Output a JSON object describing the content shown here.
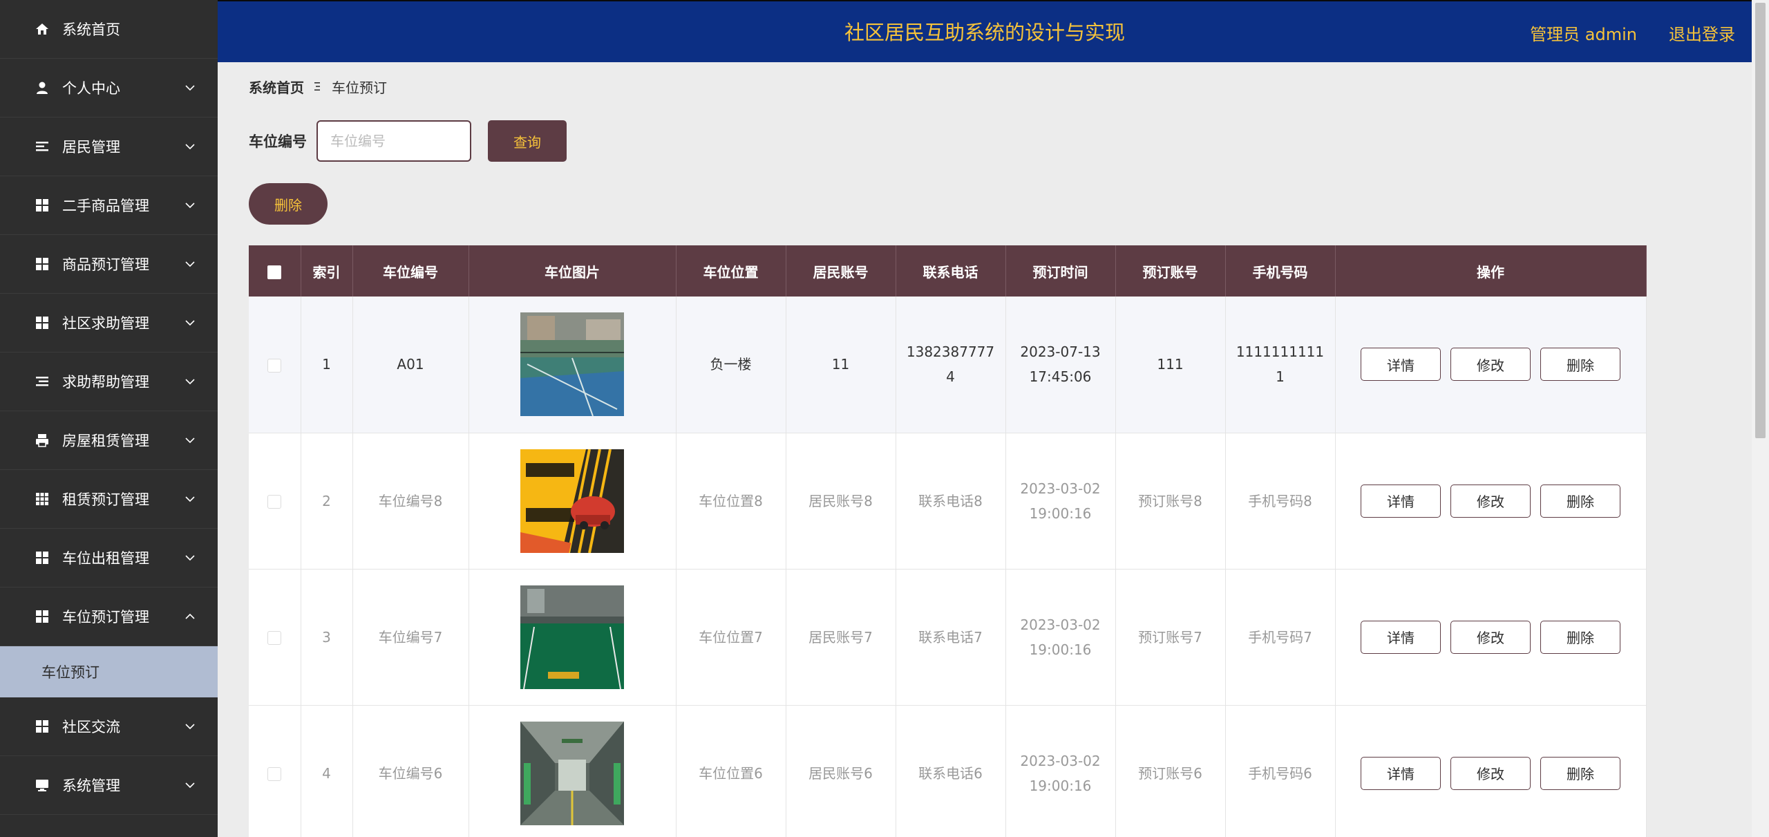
{
  "header": {
    "title": "社区居民互助系统的设计与实现",
    "admin_label": "管理员 admin",
    "logout_label": "退出登录"
  },
  "sidebar": {
    "items": [
      {
        "label": "系统首页",
        "icon": "home-icon",
        "expandable": false
      },
      {
        "label": "个人中心",
        "icon": "user-icon",
        "expandable": true
      },
      {
        "label": "居民管理",
        "icon": "list-icon",
        "expandable": true
      },
      {
        "label": "二手商品管理",
        "icon": "grid-icon",
        "expandable": true
      },
      {
        "label": "商品预订管理",
        "icon": "grid-icon",
        "expandable": true
      },
      {
        "label": "社区求助管理",
        "icon": "grid-icon",
        "expandable": true
      },
      {
        "label": "求助帮助管理",
        "icon": "list-icon",
        "expandable": true
      },
      {
        "label": "房屋租赁管理",
        "icon": "printer-icon",
        "expandable": true
      },
      {
        "label": "租赁预订管理",
        "icon": "grid-9-icon",
        "expandable": true
      },
      {
        "label": "车位出租管理",
        "icon": "grid-icon",
        "expandable": true
      },
      {
        "label": "车位预订管理",
        "icon": "grid-icon",
        "expandable": true,
        "expanded": true
      },
      {
        "label": "社区交流",
        "icon": "grid-icon",
        "expandable": true
      },
      {
        "label": "系统管理",
        "icon": "monitor-icon",
        "expandable": true
      }
    ],
    "active_submenu": "车位预订"
  },
  "breadcrumb": {
    "home": "系统首页",
    "current": "车位预订"
  },
  "search": {
    "label": "车位编号",
    "placeholder": "车位编号",
    "value": "",
    "query_label": "查询"
  },
  "toolbar": {
    "delete_label": "删除"
  },
  "table": {
    "columns": [
      "索引",
      "车位编号",
      "车位图片",
      "车位位置",
      "居民账号",
      "联系电话",
      "预订时间",
      "预订账号",
      "手机号码",
      "操作"
    ],
    "rows": [
      {
        "index": "1",
        "code": "A01",
        "image": "tennis-court",
        "location": "负一楼",
        "resident": "11",
        "phone_l1": "1382387777",
        "phone_l2": "4",
        "time_l1": "2023-07-13",
        "time_l2": "17:45:06",
        "account": "111",
        "mobile_l1": "1111111111",
        "mobile_l2": "1"
      },
      {
        "index": "2",
        "code": "车位编号8",
        "image": "parking-poster",
        "location": "车位位置8",
        "resident": "居民账号8",
        "phone_l1": "联系电话8",
        "phone_l2": "",
        "time_l1": "2023-03-02",
        "time_l2": "19:00:16",
        "account": "预订账号8",
        "mobile_l1": "手机号码8",
        "mobile_l2": ""
      },
      {
        "index": "3",
        "code": "车位编号7",
        "image": "green-parking",
        "location": "车位位置7",
        "resident": "居民账号7",
        "phone_l1": "联系电话7",
        "phone_l2": "",
        "time_l1": "2023-03-02",
        "time_l2": "19:00:16",
        "account": "预订账号7",
        "mobile_l1": "手机号码7",
        "mobile_l2": ""
      },
      {
        "index": "4",
        "code": "车位编号6",
        "image": "garage-aisle",
        "location": "车位位置6",
        "resident": "居民账号6",
        "phone_l1": "联系电话6",
        "phone_l2": "",
        "time_l1": "2023-03-02",
        "time_l2": "19:00:16",
        "account": "预订账号6",
        "mobile_l1": "手机号码6",
        "mobile_l2": ""
      }
    ],
    "row_actions": {
      "detail": "详情",
      "edit": "修改",
      "delete": "删除"
    }
  },
  "colors": {
    "sidebar_bg": "#2e2e2e",
    "header_bg": "#0c2f84",
    "accent_gold": "#f7c33a",
    "primary_brown": "#5d3c44",
    "submenu_active_bg": "#b0bcd2"
  }
}
